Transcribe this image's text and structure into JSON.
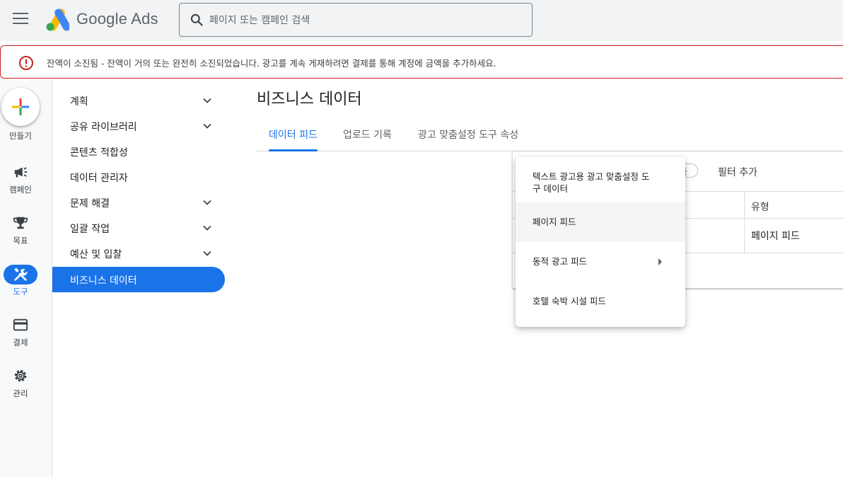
{
  "header": {
    "brand": "Google Ads",
    "search_placeholder": "페이지 또는 캠페인 검색"
  },
  "alert": {
    "text": "잔액이 소진됨 - 잔액이 거의 또는 완전히 소진되었습니다. 광고를 계속 게재하려면 결제를 통해 계정에 금액을 추가하세요."
  },
  "rail": {
    "create_label": "만들기",
    "items": [
      {
        "label": "캠페인",
        "icon": "megaphone-icon"
      },
      {
        "label": "목표",
        "icon": "trophy-icon"
      },
      {
        "label": "도구",
        "icon": "tools-icon"
      },
      {
        "label": "결제",
        "icon": "credit-card-icon"
      },
      {
        "label": "관리",
        "icon": "gear-icon"
      }
    ]
  },
  "nav": {
    "items": [
      {
        "label": "계획",
        "expandable": true
      },
      {
        "label": "공유 라이브러리",
        "expandable": true
      },
      {
        "label": "콘텐츠 적합성",
        "expandable": false
      },
      {
        "label": "데이터 관리자",
        "expandable": false
      },
      {
        "label": "문제 해결",
        "expandable": true
      },
      {
        "label": "일괄 작업",
        "expandable": true
      },
      {
        "label": "예산 및 입찰",
        "expandable": true
      },
      {
        "label": "비즈니스 데이터",
        "expandable": false
      }
    ]
  },
  "main": {
    "title": "비즈니스 데이터",
    "tabs": [
      "데이터 피드",
      "업로드 기록",
      "광고 맞춤설정 도구 속성"
    ],
    "filter_chip_fragment": "중",
    "filter_add": "필터 추가",
    "table": {
      "header_type": "유형",
      "row_type": "페이지 피드"
    }
  },
  "menu": {
    "items": [
      {
        "label": "텍스트 광고용 광고 맞춤설정 도구 데이터",
        "line1": "텍스트 광고용 광고 맞춤설정 도",
        "line2": "구 데이터"
      },
      {
        "label": "페이지 피드"
      },
      {
        "label": "동적 광고 피드",
        "has_submenu": true
      },
      {
        "label": "호텔 숙박 시설 피드"
      }
    ]
  },
  "colors": {
    "accent": "#1a73e8",
    "alert_border": "#c5221f",
    "rail_bg": "#f8f9fa"
  }
}
